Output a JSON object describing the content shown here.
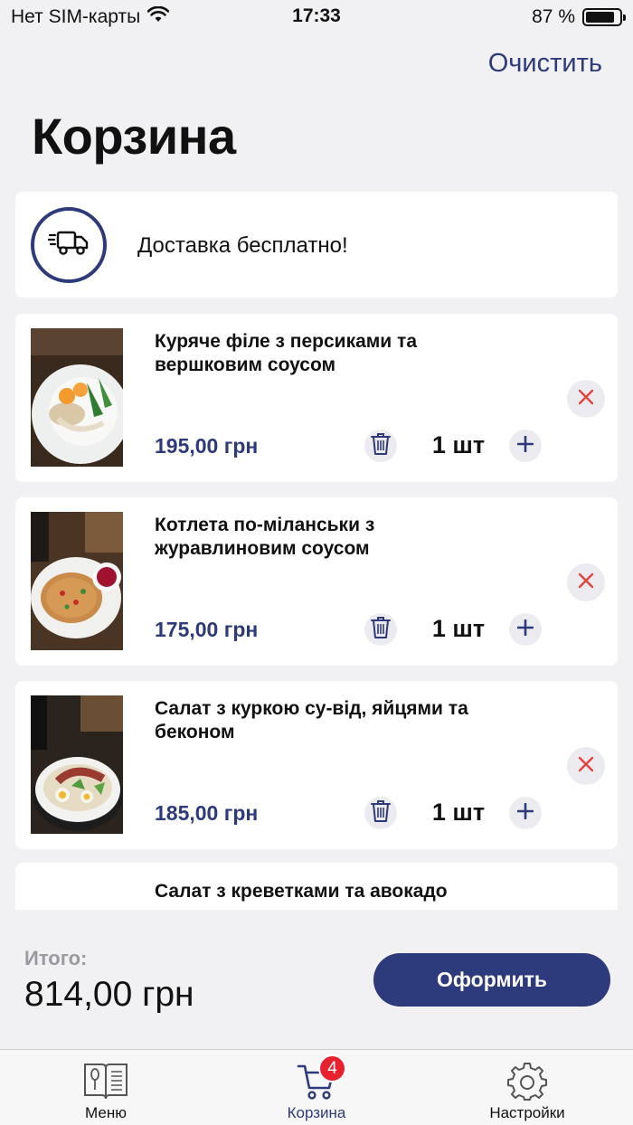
{
  "status_bar": {
    "carrier": "Нет SIM-карты",
    "time": "17:33",
    "battery_percent_text": "87 %",
    "battery_level": 0.87
  },
  "header": {
    "clear_label": "Очистить",
    "title": "Корзина"
  },
  "delivery": {
    "icon": "truck-icon",
    "text": "Доставка бесплатно!"
  },
  "cart_items": [
    {
      "name": "Куряче філе з персиками та вершковим соусом",
      "price": "195,00 грн",
      "quantity": "1 шт"
    },
    {
      "name": "Котлета по-міланськи з журавлиновим соусом",
      "price": "175,00 грн",
      "quantity": "1 шт"
    },
    {
      "name": "Салат з куркою су-від, яйцями та беконом",
      "price": "185,00 грн",
      "quantity": "1 шт"
    },
    {
      "name": "Салат з креветками та авокадо"
    }
  ],
  "summary": {
    "total_label": "Итого:",
    "total_value": "814,00 грн",
    "checkout_label": "Оформить"
  },
  "tab_bar": {
    "tabs": [
      {
        "label": "Меню",
        "icon": "menu-book-icon"
      },
      {
        "label": "Корзина",
        "icon": "cart-icon"
      },
      {
        "label": "Настройки",
        "icon": "gear-icon"
      }
    ],
    "cart_badge": "4"
  },
  "colors": {
    "accent": "#2d3a7c",
    "background": "#f1f1f3",
    "badge": "#e8212e",
    "remove_x": "#e2453d"
  }
}
